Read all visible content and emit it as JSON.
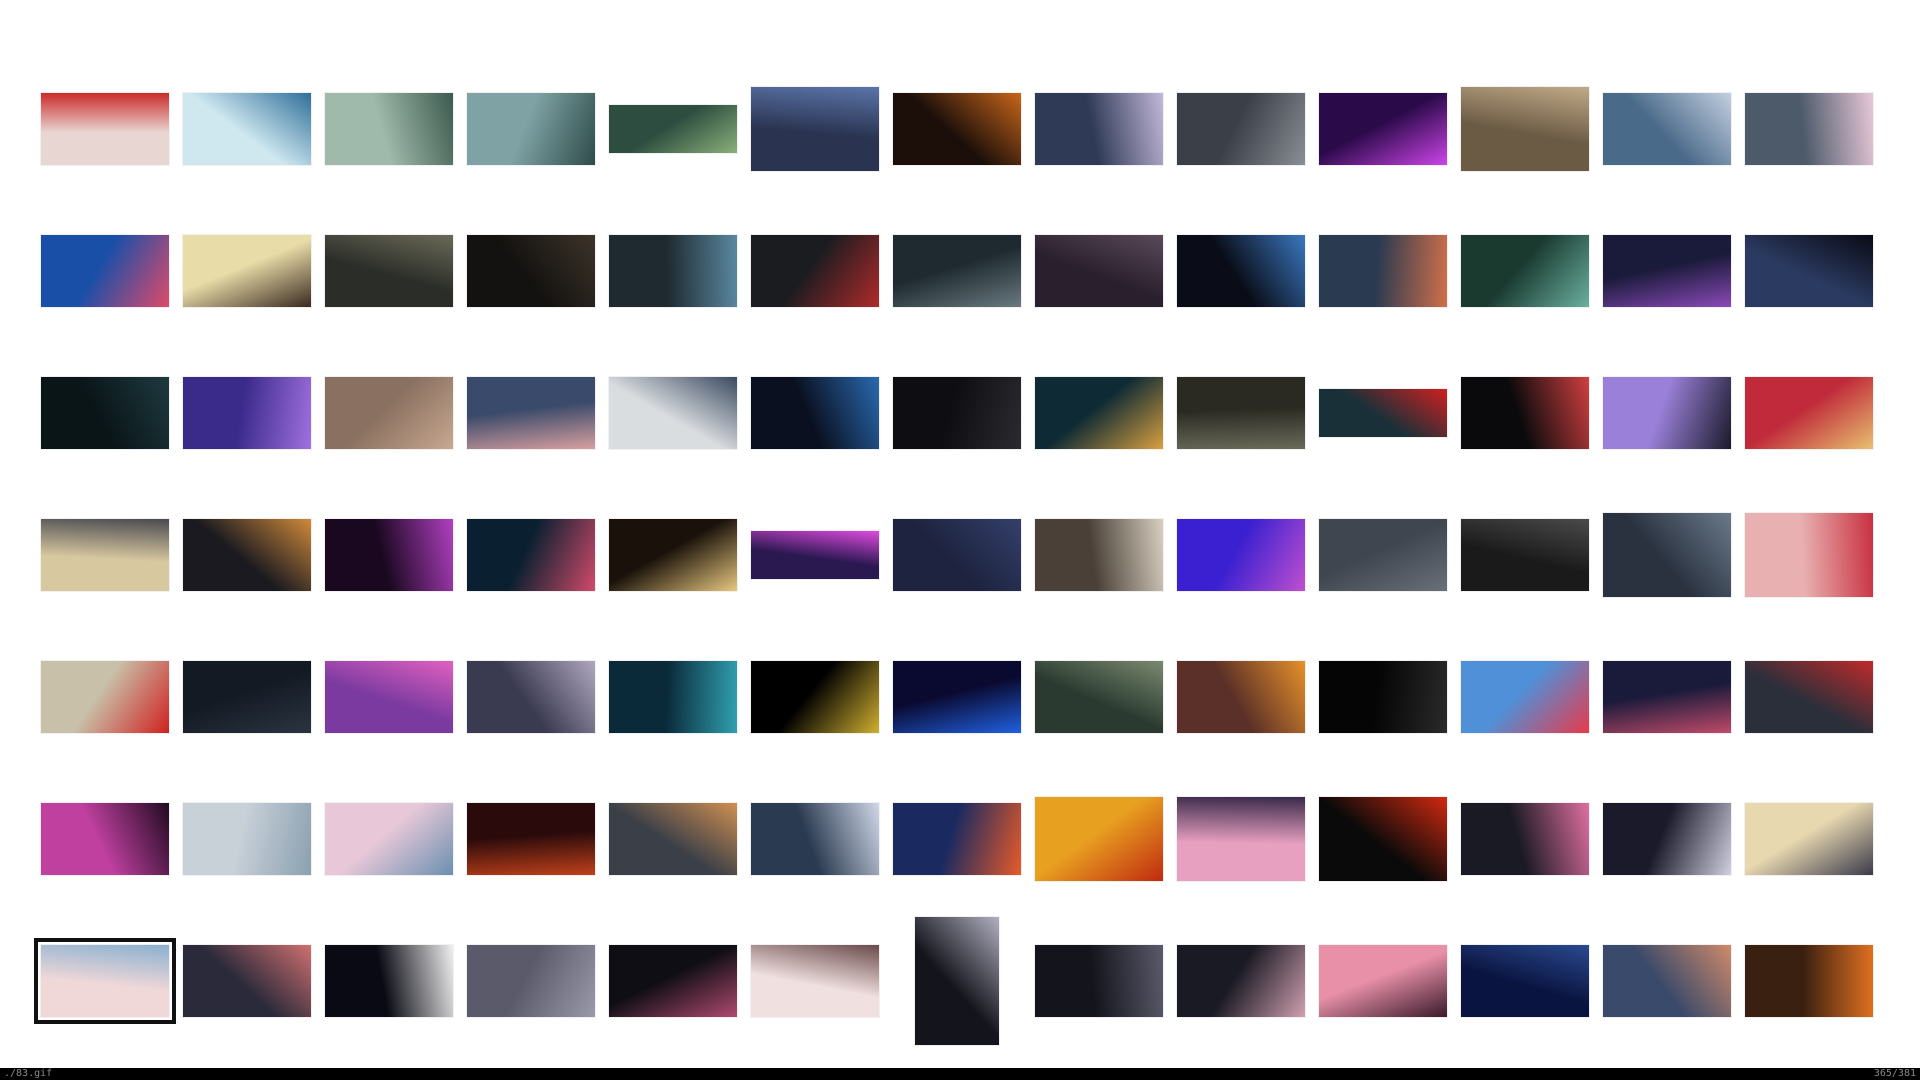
{
  "status": {
    "path": "./83.gif",
    "position": "365/381"
  },
  "thumbnails": [
    [
      "#e8d6d2",
      "#cc2a2a"
    ],
    [
      "#cfe8f0",
      "#2f6f9a"
    ],
    [
      "#9fb9aa",
      "#3c5a4e"
    ],
    [
      "#7fa3a5",
      "#2e4b4a"
    ],
    [
      "#2c4d3f",
      "#8ab07a"
    ],
    [
      "#2a3350",
      "#5a74a8"
    ],
    [
      "#1c0f0a",
      "#c8661a"
    ],
    [
      "#2e3a56",
      "#c3b8d8"
    ],
    [
      "#3a3f48",
      "#8a8f95"
    ],
    [
      "#2b0a4a",
      "#cc44e8"
    ],
    [
      "#6b5a44",
      "#c0aa88"
    ],
    [
      "#4a6a8a",
      "#c3d0e0"
    ],
    [
      "#4c5a6a",
      "#e8c8d8"
    ],
    [
      "#1a4fa8",
      "#e04a6a"
    ],
    [
      "#e8dca8",
      "#3a2a20"
    ],
    [
      "#2a2d28",
      "#6b6a58"
    ],
    [
      "#141210",
      "#3d342a"
    ],
    [
      "#1e2a30",
      "#5a88a0"
    ],
    [
      "#1a1c20",
      "#b02a2a"
    ],
    [
      "#1e2a30",
      "#6a7a80"
    ],
    [
      "#2a1f2c",
      "#5a4a5a"
    ],
    [
      "#0a0d18",
      "#3a78c0"
    ],
    [
      "#2a3a50",
      "#d0704a"
    ],
    [
      "#1a3a30",
      "#6ab0a0"
    ],
    [
      "#1a1a3a",
      "#8a4ab8"
    ],
    [
      "#2a3a60",
      "#0a0a14"
    ],
    [
      "#0a1518",
      "#1e3a40"
    ],
    [
      "#3a2a8a",
      "#a070e0"
    ],
    [
      "#8a7060",
      "#c8a890"
    ],
    [
      "#3a4a6a",
      "#d8a0a0"
    ],
    [
      "#dadde0",
      "#3a4a60"
    ],
    [
      "#0a1020",
      "#2a6ab0"
    ],
    [
      "#0e0e12",
      "#2a2a30"
    ],
    [
      "#0e2a34",
      "#d8a040"
    ],
    [
      "#2a2a22",
      "#6a6a5a"
    ],
    [
      "#1a3038",
      "#d02020"
    ],
    [
      "#0a0a0c",
      "#d04040"
    ],
    [
      "#9a80d8",
      "#1a1a2a"
    ],
    [
      "#c02a3a",
      "#e8c070"
    ],
    [
      "#d8c8a0",
      "#4a4a50"
    ],
    [
      "#1a1a20",
      "#d08a3a"
    ],
    [
      "#1a0820",
      "#b040c0"
    ],
    [
      "#0a2030",
      "#d04a6a"
    ],
    [
      "#1a120a",
      "#e8c880"
    ],
    [
      "#2a1850",
      "#e04ae0"
    ],
    [
      "#1e2440",
      "#34406a"
    ],
    [
      "#4a4038",
      "#d8d0c0"
    ],
    [
      "#3a20d0",
      "#c050d0"
    ],
    [
      "#404650",
      "#6a7078"
    ],
    [
      "#1a1a1a",
      "#4a4a4a"
    ],
    [
      "#2a3240",
      "#6a7a8a"
    ],
    [
      "#e8b0b0",
      "#c83040"
    ],
    [
      "#c8c0a8",
      "#d02020"
    ],
    [
      "#141a24",
      "#2a3440"
    ],
    [
      "#7a3aa0",
      "#e060c0"
    ],
    [
      "#3a3a50",
      "#b0a8c0"
    ],
    [
      "#0a2a3a",
      "#30a0b0"
    ],
    [
      "#000000",
      "#d0b030"
    ],
    [
      "#0a0a30",
      "#2060e0"
    ],
    [
      "#2a3a30",
      "#7a8a70"
    ],
    [
      "#5a3028",
      "#e8902a"
    ],
    [
      "#050505",
      "#2a2a2a"
    ],
    [
      "#5090d8",
      "#e83a4a"
    ],
    [
      "#1a1a3a",
      "#c04a6a"
    ],
    [
      "#2a2f3a",
      "#c02a2a"
    ],
    [
      "#c040a0",
      "#200a20"
    ],
    [
      "#c8d0d8",
      "#8aa0b0"
    ],
    [
      "#e8c8d8",
      "#6a90b0"
    ],
    [
      "#2a0a0a",
      "#c0401a"
    ],
    [
      "#3a3f48",
      "#d09050"
    ],
    [
      "#2a3a50",
      "#d0d8e8"
    ],
    [
      "#1a2a60",
      "#e85a2a"
    ],
    [
      "#e8a020",
      "#c02a10"
    ],
    [
      "#e8a0c0",
      "#3a2a4a"
    ],
    [
      "#0a0a0a",
      "#d02a10"
    ],
    [
      "#1a1a24",
      "#e070a0"
    ],
    [
      "#1a1a2a",
      "#d0d0e0"
    ],
    [
      "#e8d8b0",
      "#3a3a4a"
    ],
    [
      "#f0d8d8",
      "#8ab0d0"
    ],
    [
      "#2a2a3a",
      "#d07070"
    ],
    [
      "#0a0a14",
      "#f0f0f0"
    ],
    [
      "#5a5a6a",
      "#9a9aaa"
    ],
    [
      "#0e0e14",
      "#b04a70"
    ],
    [
      "#f0e0e0",
      "#6a4a4a"
    ],
    [
      "#14141c",
      "#b0b0c0"
    ],
    [
      "#14141c",
      "#5a5a6a"
    ],
    [
      "#1a1a24",
      "#d0a0b0"
    ],
    [
      "#e890a8",
      "#3a1a2a"
    ],
    [
      "#0a1440",
      "#2a4a90"
    ],
    [
      "#3a4a6a",
      "#d08a6a"
    ],
    [
      "#3a2010",
      "#e07020"
    ]
  ]
}
